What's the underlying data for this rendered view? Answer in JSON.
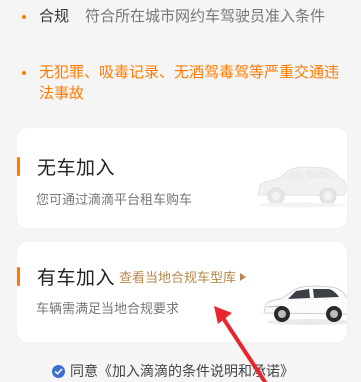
{
  "requirements": [
    {
      "title": "合规",
      "desc": "符合所在城市网约车驾驶员准入条件"
    },
    {
      "text": "无犯罪、吸毒记录、无酒驾毒驾等严重交通违法事故"
    }
  ],
  "options": {
    "no_car": {
      "title": "无车加入",
      "subtitle": "您可通过滴滴平台租车购车"
    },
    "has_car": {
      "title": "有车加入",
      "link": "查看当地合规车型库",
      "subtitle": "车辆需满足当地合规要求"
    }
  },
  "agreement": {
    "text": "同意《加入滴滴的条件说明和承诺》"
  },
  "icons": {
    "bullet": "dot-icon",
    "accent_bar": "bar-icon",
    "caret": "caret-right-icon",
    "check": "check-circle-icon",
    "annotation": "red-arrow-icon",
    "car": "car-illustration"
  },
  "colors": {
    "accent": "#ff7a00",
    "link": "#b8874c",
    "check": "#3a6fd0",
    "annotation": "#e8262b"
  }
}
